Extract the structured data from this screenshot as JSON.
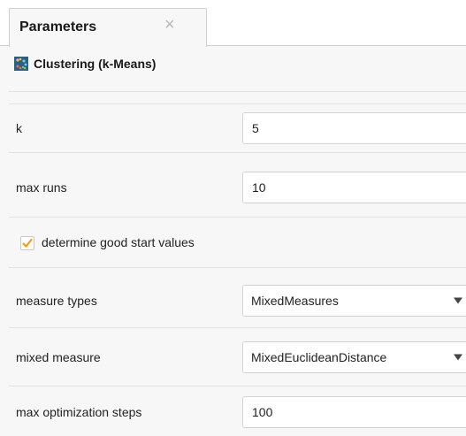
{
  "panel": {
    "tab_title": "Parameters",
    "close_glyph": "×",
    "operator_title": "Clustering (k-Means)",
    "operator_icon": "clustering-icon"
  },
  "params": {
    "k": {
      "label": "k",
      "value": "5"
    },
    "max_runs": {
      "label": "max runs",
      "value": "10"
    },
    "determine_good_start_values": {
      "label": "determine good start values",
      "checked": true
    },
    "measure_types": {
      "label": "measure types",
      "value": "MixedMeasures"
    },
    "mixed_measure": {
      "label": "mixed measure",
      "value": "MixedEuclideanDistance"
    },
    "max_optimization_steps": {
      "label": "max optimization steps",
      "value": "100"
    }
  },
  "colors": {
    "checkbox_accent": "#f39c12",
    "border": "#d4d4d4",
    "background": "#f7f7f7"
  }
}
